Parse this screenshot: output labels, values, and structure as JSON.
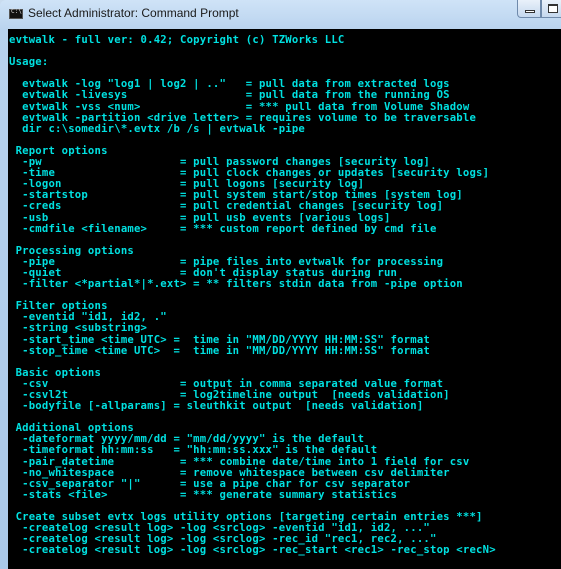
{
  "window": {
    "title": "Select Administrator: Command Prompt",
    "icon": "cmd-icon",
    "buttons": [
      "minimize",
      "maximize"
    ]
  },
  "console": {
    "text_color": "#00e1e1",
    "background": "#000000",
    "lines": [
      "evtwalk - full ver: 0.42; Copyright (c) TZWorks LLC",
      "",
      "Usage:",
      "",
      "  evtwalk -log \"log1 | log2 | ..\"   = pull data from extracted logs",
      "  evtwalk -livesys                  = pull data from the running OS",
      "  evtwalk -vss <num>                = *** pull data from Volume Shadow",
      "  evtwalk -partition <drive letter> = requires volume to be traversable",
      "  dir c:\\somedir\\*.evtx /b /s | evtwalk -pipe",
      "",
      " Report options",
      "  -pw                     = pull password changes [security log]",
      "  -time                   = pull clock changes or updates [security logs]",
      "  -logon                  = pull logons [security log]",
      "  -startstop              = pull system start/stop times [system log]",
      "  -creds                  = pull credential changes [security log]",
      "  -usb                    = pull usb events [various logs]",
      "  -cmdfile <filename>     = *** custom report defined by cmd file",
      "",
      " Processing options",
      "  -pipe                   = pipe files into evtwalk for processing",
      "  -quiet                  = don't display status during run",
      "  -filter <*partial*|*.ext> = ** filters stdin data from -pipe option",
      "",
      " Filter options",
      "  -eventid \"id1, id2, .\"",
      "  -string <substring>",
      "  -start_time <time UTC> =  time in \"MM/DD/YYYY HH:MM:SS\" format",
      "  -stop_time <time UTC>  =  time in \"MM/DD/YYYY HH:MM:SS\" format",
      "",
      " Basic options",
      "  -csv                    = output in comma separated value format",
      "  -csvl2t                 = log2timeline output  [needs validation]",
      "  -bodyfile [-allparams] = sleuthkit output  [needs validation]",
      "",
      " Additional options",
      "  -dateformat yyyy/mm/dd = \"mm/dd/yyyy\" is the default",
      "  -timeformat hh:mm:ss   = \"hh:mm:ss.xxx\" is the default",
      "  -pair_datetime          = *** combine date/time into 1 field for csv",
      "  -no_whitespace          = remove whitespace between csv delimiter",
      "  -csv_separator \"|\"      = use a pipe char for csv separator",
      "  -stats <file>           = *** generate summary statistics",
      "",
      " Create subset evtx logs utility options [targeting certain entries ***]",
      "  -createlog <result log> -log <srclog> -eventid \"id1, id2, ...\"",
      "  -createlog <result log> -log <srclog> -rec_id \"rec1, rec2, ...\"",
      "  -createlog <result log> -log <srclog> -rec_start <rec1> -rec_stop <recN>"
    ]
  }
}
